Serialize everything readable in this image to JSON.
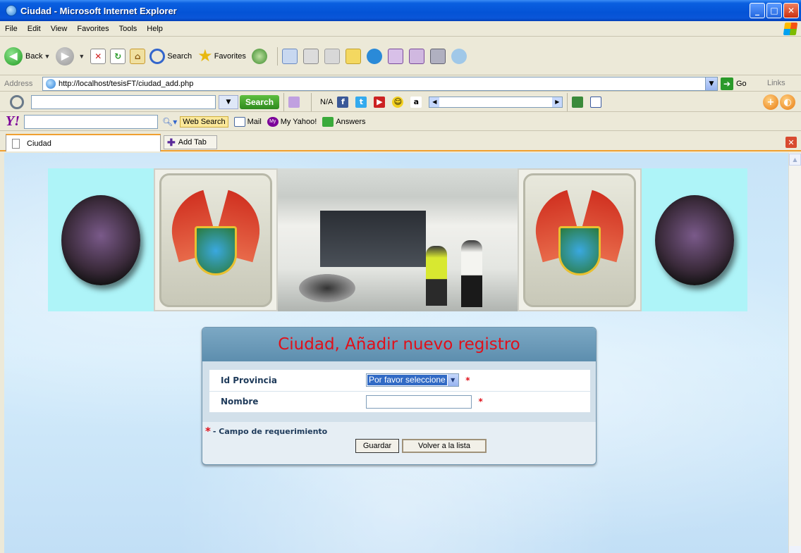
{
  "window": {
    "title": "Ciudad - Microsoft Internet Explorer",
    "controls": [
      "_",
      "□",
      "✕"
    ]
  },
  "menu": [
    "File",
    "Edit",
    "View",
    "Favorites",
    "Tools",
    "Help"
  ],
  "toolbar": {
    "back_label": "Back",
    "search_label": "Search",
    "favorites_label": "Favorites"
  },
  "address": {
    "label": "Address",
    "url": "http://localhost/tesisFT/ciudad_add.php",
    "go_label": "Go",
    "links_label": "Links"
  },
  "search_toolbar": {
    "search_button": "Search",
    "na_label": "N/A"
  },
  "yahoo_bar": {
    "logo": "Y!",
    "web_search": "Web Search",
    "mail": "Mail",
    "my_yahoo": "My Yahoo!",
    "answers": "Answers"
  },
  "tabs": {
    "active_tab": "Ciudad",
    "add_tab": "Add Tab"
  },
  "form": {
    "title": "Ciudad, Añadir nuevo registro",
    "fields": [
      {
        "label": "Id Provincia",
        "value": "Por favor seleccione",
        "required_mark": "*"
      },
      {
        "label": "Nombre",
        "value": "",
        "required_mark": "*"
      }
    ],
    "required_note": "- Campo de requerimiento",
    "required_star": "*",
    "save_button": "Guardar",
    "back_button": "Volver a la lista"
  },
  "colors": {
    "title_red": "#e0101a",
    "panel_header": "#6b9aba",
    "xp_blue": "#0453d6"
  }
}
